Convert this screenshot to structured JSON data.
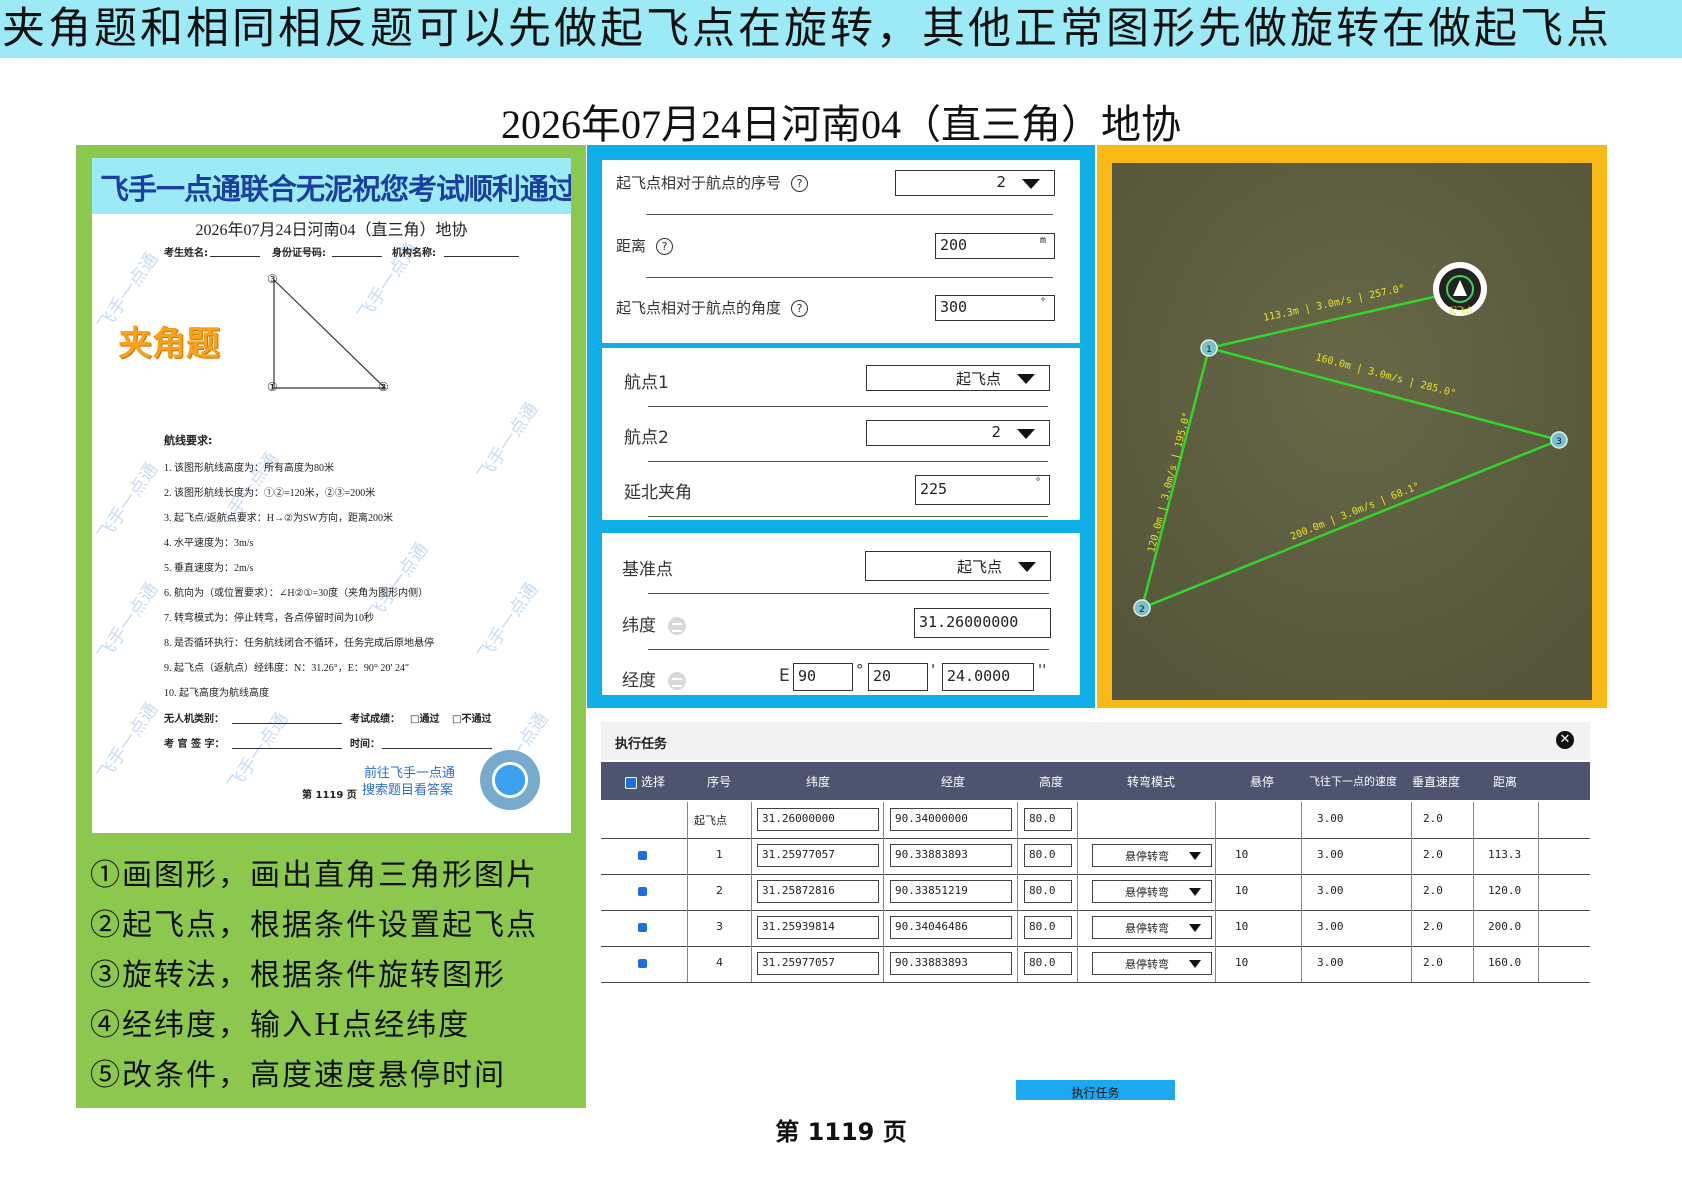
{
  "banner": "夹角题和相同相反题可以先做起飞点在旋转，其他正常图形先做旋转在做起飞点",
  "doc_title": "2026年07月24日河南04（直三角）地协",
  "paper": {
    "banner": "飞手一点通联合无泥祝您考试顺利通过",
    "title": "2026年07月24日河南04（直三角）地协",
    "info": [
      "考生姓名:",
      "身份证号码:",
      "机构名称:"
    ],
    "watermark": "飞手一点通",
    "tag": "夹角题",
    "points": [
      "③",
      "①",
      "②"
    ],
    "req_title": "航线要求:",
    "requirements": [
      "1.  该图形航线高度为：所有高度为80米",
      "2.  该图形航线长度为：①②=120米，②③=200米",
      "3.  起飞点/返航点要求：H→②为SW方向，距离200米",
      "4.  水平速度为：3m/s",
      "5.  垂直速度为：2m/s",
      "6.  航向为（或位置要求）：∠H②①=30度（夹角为图形内侧）",
      "7.  转弯模式为：停止转弯，各点停留时间为10秒",
      "8.  是否循环执行：任务航线闭合不循环，任务完成后原地悬停",
      "9.  起飞点（返航点）经纬度：N：31.26°，E：90° 20′ 24″",
      "10. 起飞高度为航线高度"
    ],
    "footer1": [
      "无人机类别：",
      "考试成绩：",
      "□通过",
      "□不通过"
    ],
    "footer2": [
      "考 官 签 字：",
      "时间："
    ],
    "page": "第 1119 页",
    "ad": [
      "前往飞手一点通",
      "搜索题目看答案"
    ]
  },
  "steps": [
    "①画图形，画出直角三角形图片",
    "②起飞点，根据条件设置起飞点",
    "③旋转法，根据条件旋转图形",
    "④经纬度，输入H点经纬度",
    "⑤改条件，高度速度悬停时间"
  ],
  "card1": {
    "seq_label": "起飞点相对于航点的序号",
    "seq_value": "2",
    "dist_label": "距离",
    "dist_value": "200",
    "dist_unit": "m",
    "angle_label": "起飞点相对于航点的角度",
    "angle_value": "300",
    "angle_unit": "°",
    "help": "?"
  },
  "card2": {
    "wp1_label": "航点1",
    "wp1_value": "起飞点",
    "wp2_label": "航点2",
    "wp2_value": "2",
    "north_label": "延北夹角",
    "north_value": "225",
    "north_unit": "°"
  },
  "card3": {
    "ref_label": "基准点",
    "ref_value": "起飞点",
    "lat_label": "纬度",
    "lat_value": "31.26000000",
    "lon_label": "经度",
    "lon_prefix": "E",
    "lon_deg": "90",
    "lon_min": "20",
    "lon_sec": "24.0000",
    "deg_sym": "°",
    "min_sym": "'",
    "sec_sym": "''"
  },
  "map": {
    "home_label": "起飞点",
    "waypoints": [
      "1",
      "2",
      "3"
    ],
    "segments": [
      "113.3m | 3.0m/s | 257.0°",
      "160.0m | 3.0m/s | 285.0°",
      "120.0m | 3.0m/s | 195.0°",
      "200.0m | 3.0m/s | 68.1°"
    ],
    "bg_color": "#5d5e3e",
    "line_color": "#32d62a",
    "label_color": "#e7e22a"
  },
  "task": {
    "title": "执行任务",
    "close": "✕",
    "columns": [
      "选择",
      "序号",
      "纬度",
      "经度",
      "高度",
      "转弯模式",
      "悬停",
      "飞往下一点的速度",
      "垂直速度",
      "距离"
    ],
    "rows": [
      {
        "seq": "起飞点",
        "lat": "31.26000000",
        "lon": "90.34000000",
        "alt": "80.0",
        "mode": "",
        "hover": "",
        "speed": "3.00",
        "vspeed": "2.0",
        "dist": ""
      },
      {
        "seq": "1",
        "lat": "31.25977057",
        "lon": "90.33883893",
        "alt": "80.0",
        "mode": "悬停转弯",
        "hover": "10",
        "speed": "3.00",
        "vspeed": "2.0",
        "dist": "113.3"
      },
      {
        "seq": "2",
        "lat": "31.25872816",
        "lon": "90.33851219",
        "alt": "80.0",
        "mode": "悬停转弯",
        "hover": "10",
        "speed": "3.00",
        "vspeed": "2.0",
        "dist": "120.0"
      },
      {
        "seq": "3",
        "lat": "31.25939814",
        "lon": "90.34046486",
        "alt": "80.0",
        "mode": "悬停转弯",
        "hover": "10",
        "speed": "3.00",
        "vspeed": "2.0",
        "dist": "200.0"
      },
      {
        "seq": "4",
        "lat": "31.25977057",
        "lon": "90.33883893",
        "alt": "80.0",
        "mode": "悬停转弯",
        "hover": "10",
        "speed": "3.00",
        "vspeed": "2.0",
        "dist": "160.0"
      }
    ],
    "exec_button": "执行任务"
  },
  "page_number": "第 1119 页"
}
